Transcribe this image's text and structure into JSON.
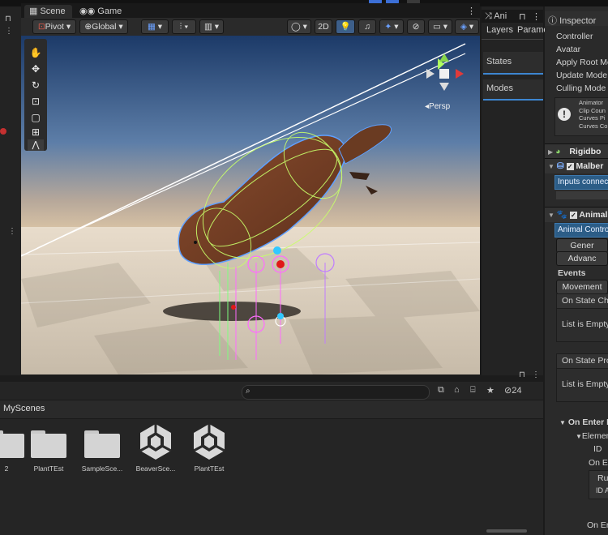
{
  "scene_tabs": {
    "scene": "Scene",
    "game": "Game"
  },
  "scene_toolbar": {
    "pivot": "Pivot",
    "global": "Global",
    "mode_2d": "2D"
  },
  "scene_view": {
    "persp_label": "Persp"
  },
  "animator_panel": {
    "tab_label": "Ani",
    "tabs": [
      "Layers",
      "Parame"
    ],
    "sections": [
      "States",
      "Modes"
    ]
  },
  "inspector": {
    "title": "Inspector",
    "animator_fields": [
      "Controller",
      "Avatar",
      "Apply Root Mo",
      "Update Mode",
      "Culling Mode"
    ],
    "info_lines": [
      "Animator",
      "Clip Coun",
      "Curves Pi",
      "Curves Co"
    ],
    "components": [
      {
        "label": "Rigidbo",
        "icon": "rigidbody-icon"
      },
      {
        "label": "Malber",
        "icon": "script-icon"
      },
      {
        "label": "Animal",
        "icon": "paw-icon"
      }
    ],
    "inputs_connect": "Inputs connec",
    "animal_controller": "Animal Contro",
    "buttons": [
      "Gener",
      "Advanc"
    ],
    "events_label": "Events",
    "movement_label": "Movement",
    "on_state_change": "On State Cha",
    "list_empty_1": "List is Empty",
    "on_state_profile": "On State Prof",
    "list_empty_2": "List is Empty",
    "on_enter_exit": "On Enter Ex",
    "element": "Elemen",
    "id_label": "ID",
    "on_enter": "On Ent",
    "ru": "Ru",
    "id_a": "ID A",
    "on_en_bottom": "On En"
  },
  "project": {
    "breadcrumb": "MyScenes",
    "search_placeholder": "",
    "count": "24",
    "assets": [
      {
        "name": "2",
        "type": "folder"
      },
      {
        "name": "PlantTEst",
        "type": "folder"
      },
      {
        "name": "SampleSce...",
        "type": "folder"
      },
      {
        "name": "BeaverSce...",
        "type": "unity-scene"
      },
      {
        "name": "PlantTEst",
        "type": "unity-scene"
      }
    ]
  }
}
